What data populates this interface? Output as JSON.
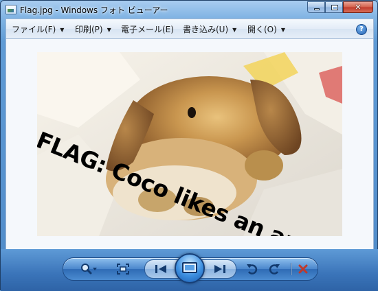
{
  "window": {
    "title": "Flag.jpg - Windows フォト ビューアー",
    "caption_buttons": [
      "minimize",
      "maximize",
      "close"
    ]
  },
  "menu": {
    "items": [
      {
        "label": "ファイル(F)",
        "has_dropdown": true
      },
      {
        "label": "印刷(P)",
        "has_dropdown": true
      },
      {
        "label": "電子メール(E)",
        "has_dropdown": false
      },
      {
        "label": "書き込み(U)",
        "has_dropdown": true
      },
      {
        "label": "開く(O)",
        "has_dropdown": true
      }
    ],
    "help_label": "?"
  },
  "photo": {
    "overlay_text": "FLAG: Coco likes an apple",
    "subject": "lop-eared rabbit on white blanket"
  },
  "controls": {
    "icons": [
      "zoom-icon",
      "fit-window-icon",
      "previous-icon",
      "slideshow-icon",
      "next-icon",
      "rotate-counterclockwise-icon",
      "rotate-clockwise-icon",
      "delete-icon"
    ],
    "accent": "#3a74b9",
    "delete_color": "#c0392b"
  }
}
